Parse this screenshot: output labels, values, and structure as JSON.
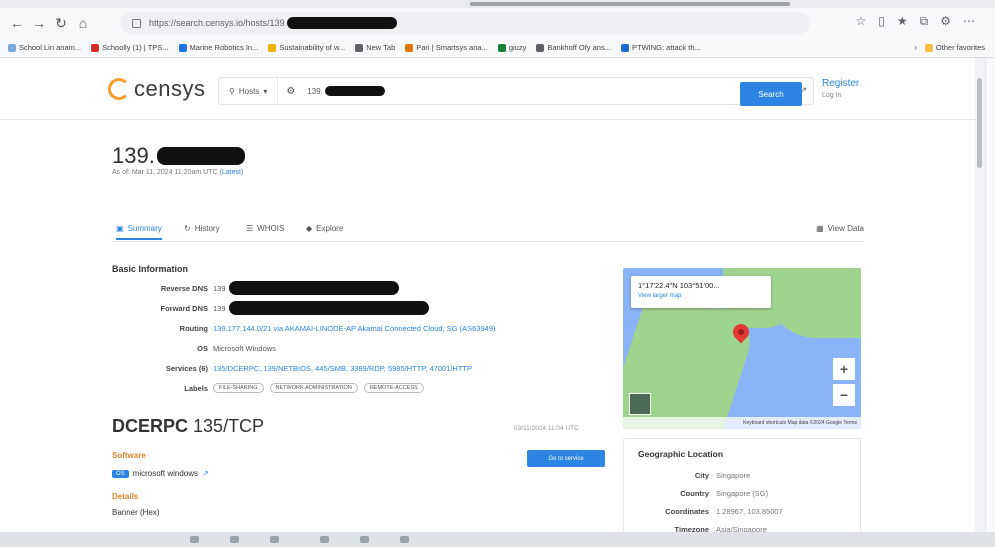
{
  "browser": {
    "url": "https://search.censys.io/hosts/139",
    "toolbar_icons": [
      "star-icon",
      "split-icon",
      "favorites-icon",
      "collections-icon",
      "extensions-icon",
      "more-icon"
    ],
    "bookmarks": [
      {
        "label": "School Lin anam...",
        "color": "#7aa7d9"
      },
      {
        "label": "Schoolly (1) | TPS...",
        "color": "#d93025"
      },
      {
        "label": "Marine Robotics In...",
        "color": "#1a73e8"
      },
      {
        "label": "Sustainability of w...",
        "color": "#f9ab00"
      },
      {
        "label": "New Tab",
        "color": "#5f6368"
      },
      {
        "label": "Pari | Smartsys ana...",
        "color": "#e37400"
      },
      {
        "label": "giuzy",
        "color": "#188038"
      },
      {
        "label": "Bankhoff Ofy ans...",
        "color": "#5f6368"
      },
      {
        "label": "PTWING: attack th...",
        "color": "#1967d2"
      }
    ],
    "other_favorites": "Other favorites"
  },
  "site": {
    "logo_text": "censys",
    "search": {
      "scope": "Hosts",
      "query_prefix": "139.",
      "button": "Search"
    },
    "register": "Register",
    "login": "Log In"
  },
  "host": {
    "ip_prefix": "139.",
    "as_of": "As of: Mar 11, 2024 11:20am UTC",
    "latest": "Latest"
  },
  "tabs": [
    {
      "label": "Summary",
      "icon": "summary-icon",
      "active": true
    },
    {
      "label": "History",
      "icon": "history-icon",
      "active": false
    },
    {
      "label": "WHOIS",
      "icon": "whois-icon",
      "active": false
    },
    {
      "label": "Explore",
      "icon": "explore-icon",
      "active": false
    }
  ],
  "raw_data": "View Data",
  "basic_info": {
    "title": "Basic Information",
    "reverse_dns_label": "Reverse DNS",
    "reverse_dns_prefix": "139",
    "forward_dns_label": "Forward DNS",
    "forward_dns_prefix": "139",
    "routing_label": "Routing",
    "routing_value": "139.177.144.0/21 via AKAMAI-LINODE-AP Akamai Connected Cloud, SG (AS63949)",
    "os_label": "OS",
    "os_value": "Microsoft Windows",
    "services_label": "Services (6)",
    "services_value": "135/DCERPC, 139/NETBIOS, 445/SMB, 3389/RDP, 5985/HTTP, 47001/HTTP",
    "labels_label": "Labels",
    "labels": [
      "FILE-SHARING",
      "NETWORK.ADMINISTRATION",
      "REMOTE-ACCESS"
    ]
  },
  "map": {
    "coords": "1°17'22.4\"N 103°51'00...",
    "larger_map": "View larger map",
    "footer": "Keyboard shortcuts  Map data ©2024 Google  Terms"
  },
  "service": {
    "name": "DCERPC",
    "port": "135/TCP",
    "timestamp": "03/11/2024 11:04 UTC",
    "software_label": "Software",
    "os_badge": "OS",
    "software_value": "microsoft windows",
    "details_label": "Details",
    "banner_label": "Banner (Hex)",
    "button": "Go to service"
  },
  "geo": {
    "title": "Geographic Location",
    "city_label": "City",
    "city": "Singapore",
    "country_label": "Country",
    "country": "Singapore (SG)",
    "coord_label": "Coordinates",
    "coord": "1.28967, 103.85007",
    "timezone_label": "Timezone",
    "timezone": "Asia/Singapore"
  }
}
